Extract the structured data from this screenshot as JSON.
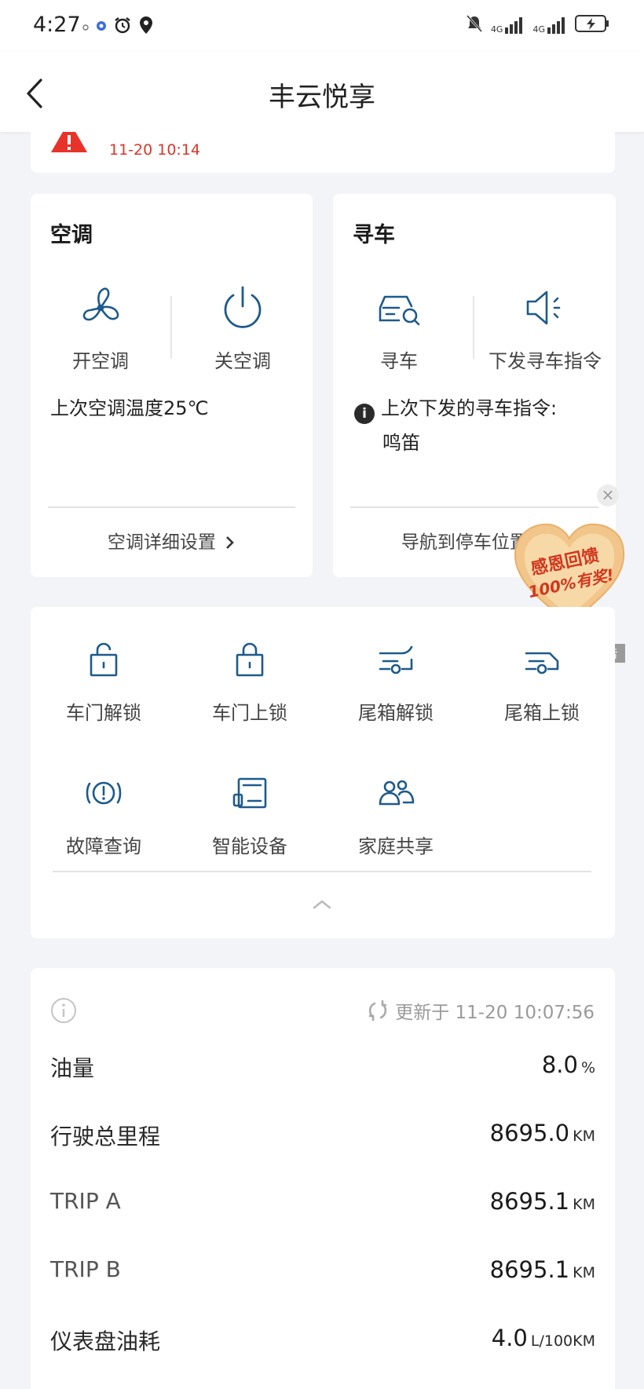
{
  "status_bar": {
    "time": "4:27",
    "network_1": "4G",
    "network_2": "4G"
  },
  "header": {
    "title": "丰云悦享"
  },
  "alert": {
    "time": "11-20 10:14",
    "color": "#d9362b"
  },
  "ac": {
    "title": "空调",
    "on_label": "开空调",
    "off_label": "关空调",
    "last_temp": "上次空调温度25℃",
    "settings_link": "空调详细设置",
    "accent": "#1d5a8c"
  },
  "find_car": {
    "title": "寻车",
    "find_label": "寻车",
    "send_label": "下发寻车指令",
    "last_cmd_label": "上次下发的寻车指令:",
    "last_cmd_value": "鸣笛",
    "nav_link": "导航到停车位置"
  },
  "ad": {
    "line1": "感恩回馈",
    "line2": "100%有奖!",
    "tag": "广告",
    "close": "×"
  },
  "controls": {
    "items": [
      {
        "label": "车门解锁",
        "icon": "unlock-icon"
      },
      {
        "label": "车门上锁",
        "icon": "lock-icon"
      },
      {
        "label": "尾箱解锁",
        "icon": "trunk-unlock-icon"
      },
      {
        "label": "尾箱上锁",
        "icon": "trunk-lock-icon"
      },
      {
        "label": "故障查询",
        "icon": "fault-icon"
      },
      {
        "label": "智能设备",
        "icon": "smart-device-icon"
      },
      {
        "label": "家庭共享",
        "icon": "family-share-icon"
      }
    ]
  },
  "stats": {
    "updated": "更新于 11-20 10:07:56",
    "rows": [
      {
        "label": "油量",
        "value": "8.0",
        "unit": "%"
      },
      {
        "label": "行驶总里程",
        "value": "8695.0",
        "unit": "KM"
      },
      {
        "label": "TRIP A",
        "value": "8695.1",
        "unit": "KM"
      },
      {
        "label": "TRIP B",
        "value": "8695.1",
        "unit": "KM"
      },
      {
        "label": "仪表盘油耗",
        "value": "4.0",
        "unit": "L/100KM"
      }
    ]
  }
}
